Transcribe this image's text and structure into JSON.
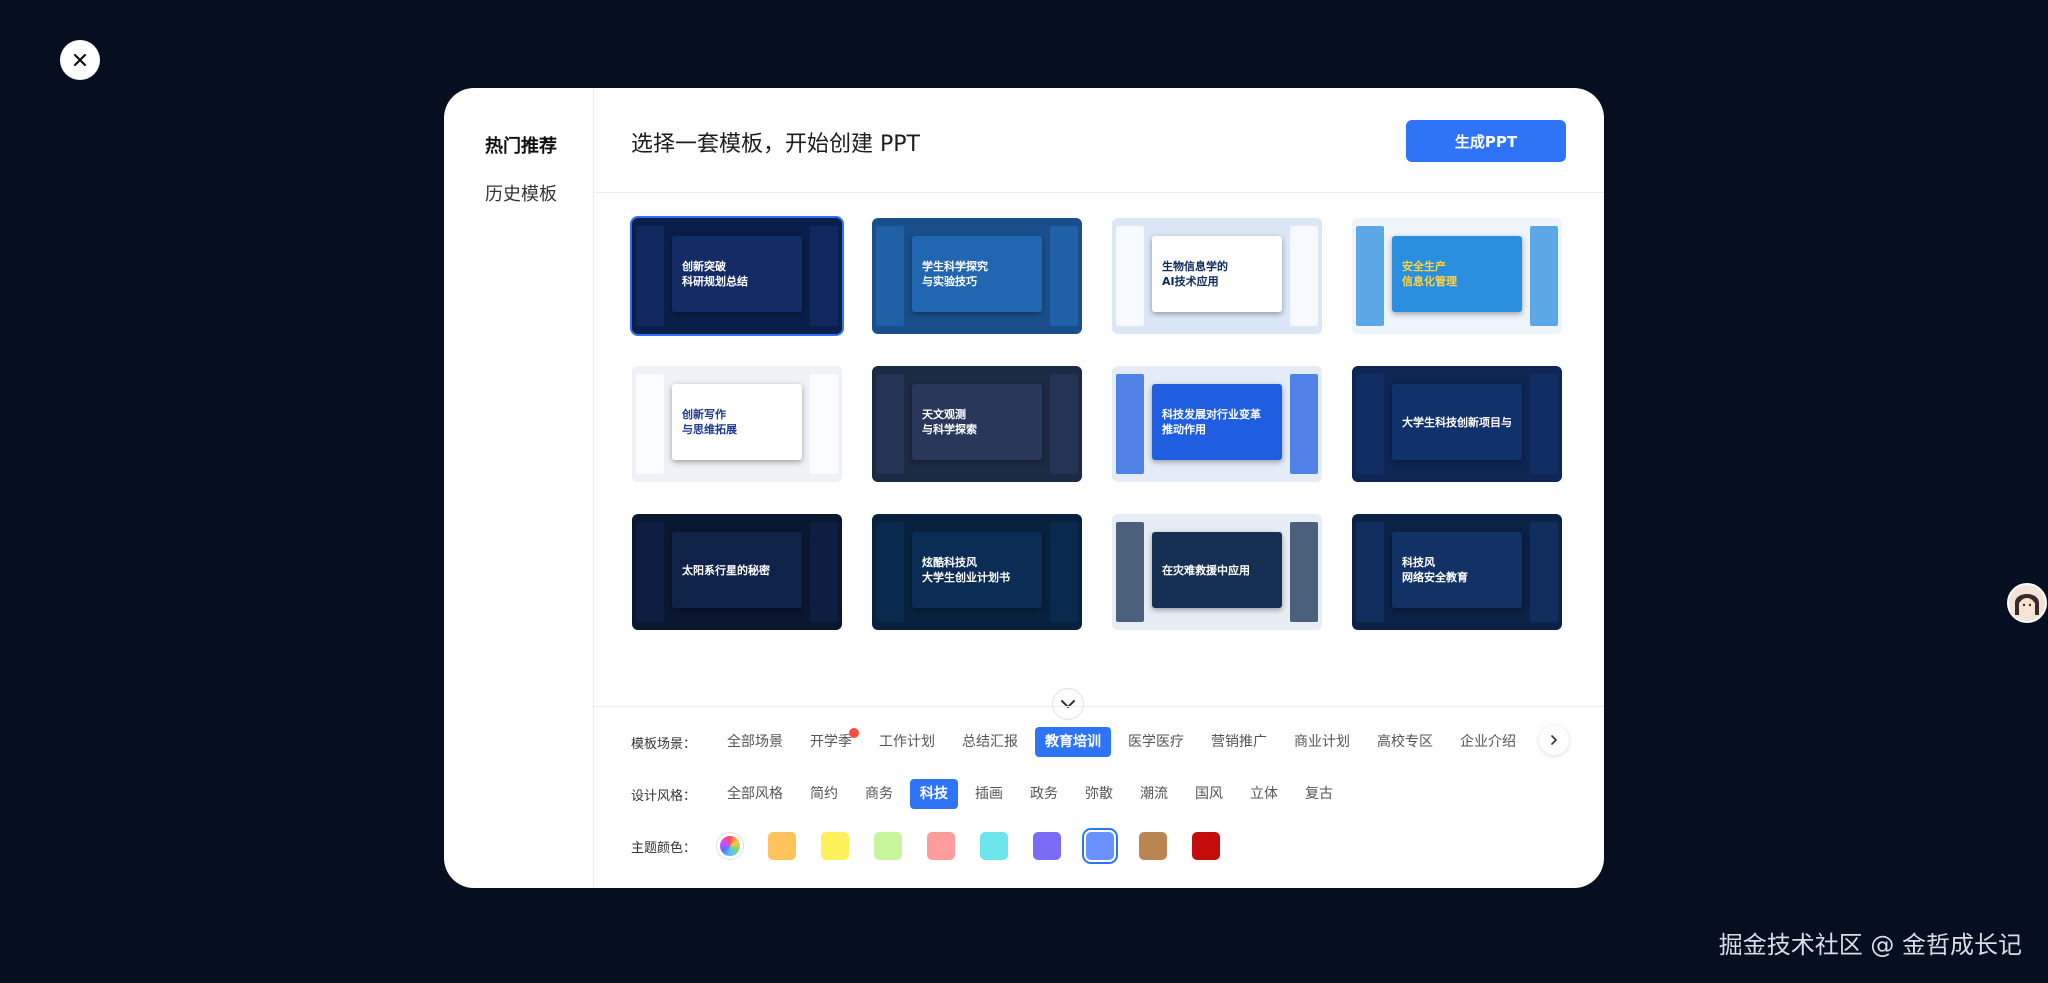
{
  "close_label": "",
  "sidebar": {
    "items": [
      {
        "label": "热门推荐",
        "active": true
      },
      {
        "label": "历史模板",
        "active": false
      }
    ]
  },
  "header": {
    "title": "选择一套模板，开始创建 PPT",
    "generate_label": "生成PPT"
  },
  "templates": [
    {
      "lines": [
        "创新突破",
        "科研规划总结"
      ],
      "bg": "#0b1e4a",
      "slide": "#142c66",
      "text_color": "#ffffff",
      "selected": true
    },
    {
      "lines": [
        "学生科学探究",
        "与实验技巧"
      ],
      "bg": "#1a4f8c",
      "slide": "#2166b0",
      "text_color": "#ffffff",
      "selected": false
    },
    {
      "lines": [
        "生物信息学的",
        "AI技术应用"
      ],
      "bg": "#dbe7f6",
      "slide": "#ffffff",
      "text_color": "#0e2a5c",
      "selected": false
    },
    {
      "lines": [
        "安全生产",
        "信息化管理"
      ],
      "bg": "#eef4fb",
      "slide": "#2b8fe0",
      "text_color": "#ffd23f",
      "selected": false
    },
    {
      "lines": [
        "创新写作",
        "与思维拓展"
      ],
      "bg": "#eef1f6",
      "slide": "#ffffff",
      "text_color": "#1f3a93",
      "selected": false
    },
    {
      "lines": [
        "天文观测",
        "与科学探索"
      ],
      "bg": "#1d2a44",
      "slide": "#27385a",
      "text_color": "#ffffff",
      "selected": false
    },
    {
      "lines": [
        "科技发展对行业变革",
        "推动作用"
      ],
      "bg": "#e4ecf8",
      "slide": "#1f5ee0",
      "text_color": "#ffffff",
      "selected": false
    },
    {
      "lines": [
        "大学生科技创新项目与实践应用"
      ],
      "bg": "#0d2653",
      "slide": "#11316a",
      "text_color": "#ffffff",
      "selected": false
    },
    {
      "lines": [
        "太阳系行星的秘密"
      ],
      "bg": "#0a1730",
      "slide": "#0f2248",
      "text_color": "#ffffff",
      "selected": false
    },
    {
      "lines": [
        "炫酷科技风",
        "大学生创业计划书"
      ],
      "bg": "#07213f",
      "slide": "#0b2c55",
      "text_color": "#ffffff",
      "selected": false
    },
    {
      "lines": [
        "在灾难救援中应用"
      ],
      "bg": "#e7edf5",
      "slide": "#153052",
      "text_color": "#ffffff",
      "selected": false
    },
    {
      "lines": [
        "科技风",
        "网络安全教育"
      ],
      "bg": "#0c2146",
      "slide": "#123266",
      "text_color": "#ffffff",
      "selected": false
    }
  ],
  "filters": {
    "scene": {
      "label": "模板场景：",
      "options": [
        "全部场景",
        "开学季",
        "工作计划",
        "总结汇报",
        "教育培训",
        "医学医疗",
        "营销推广",
        "商业计划",
        "高校专区",
        "企业介绍"
      ],
      "active_index": 4,
      "hot_index": 1
    },
    "style": {
      "label": "设计风格：",
      "options": [
        "全部风格",
        "简约",
        "商务",
        "科技",
        "插画",
        "政务",
        "弥散",
        "潮流",
        "国风",
        "立体",
        "复古"
      ],
      "active_index": 3
    },
    "color": {
      "label": "主题颜色：",
      "swatches": [
        "#ffc35c",
        "#fdf05a",
        "#c6f59c",
        "#ff9c9c",
        "#6ce6ec",
        "#7a6cf5",
        "#6a92ff",
        "#b98552",
        "#c40c0c"
      ],
      "selected_index": 6
    }
  },
  "watermark": "掘金技术社区 @ 金哲成长记"
}
